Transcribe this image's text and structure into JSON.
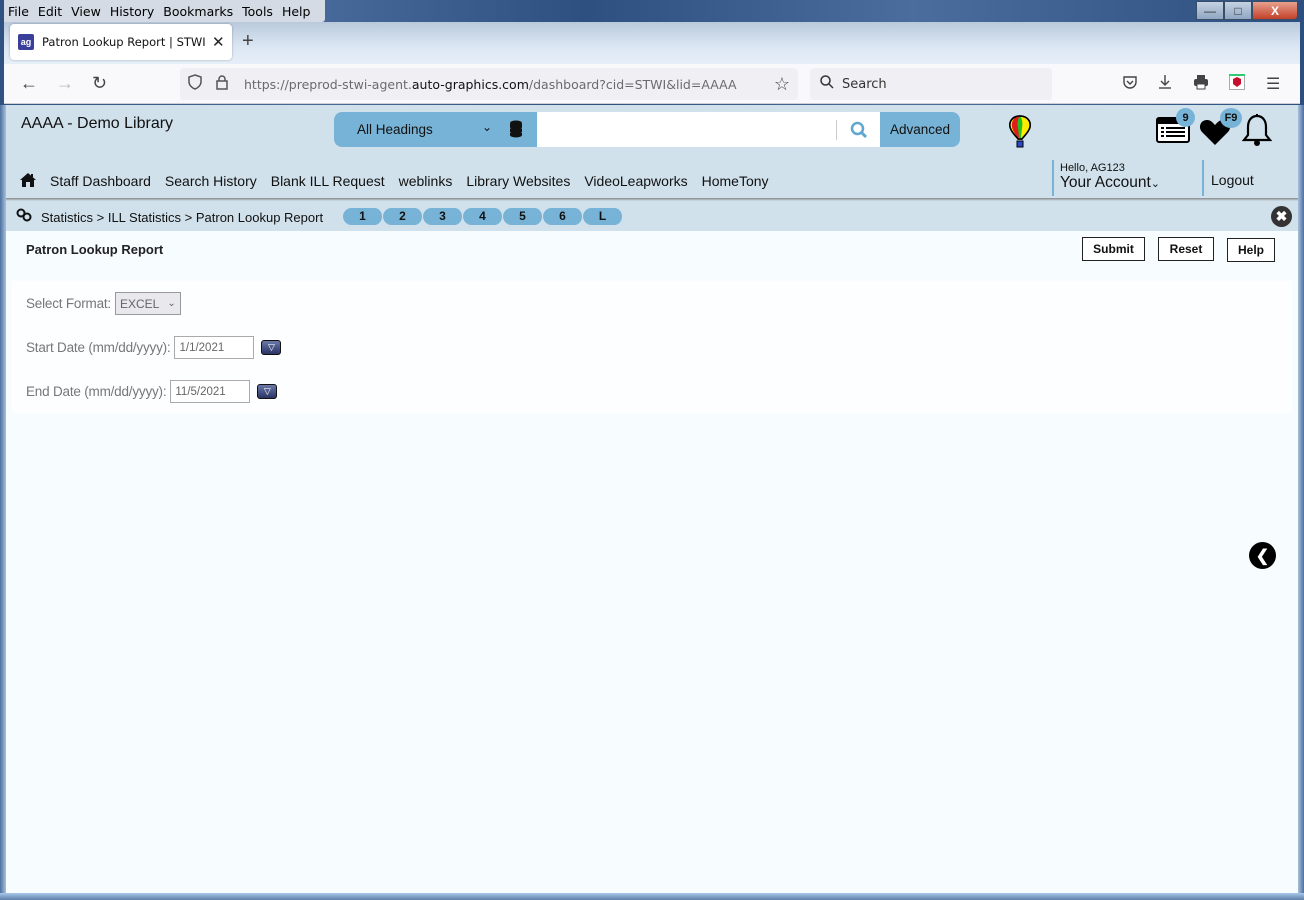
{
  "browser": {
    "menu": [
      "File",
      "Edit",
      "View",
      "History",
      "Bookmarks",
      "Tools",
      "Help"
    ],
    "tab_title": "Patron Lookup Report | STWI | a",
    "favicon_text": "ag",
    "url_prefix": "https://preprod-stwi-agent.",
    "url_domain": "auto-graphics.com",
    "url_suffix": "/dashboard?cid=STWI&lid=AAAA",
    "search_placeholder": "Search"
  },
  "header": {
    "library_name": "AAAA - Demo Library",
    "search_scope": "All Headings",
    "search_value": "",
    "advanced_label": "Advanced",
    "list_badge": "9",
    "favorites_badge": "F9",
    "hello": "Hello, AG123",
    "account_label": "Your Account",
    "logout_label": "Logout"
  },
  "nav": {
    "items": [
      "Staff Dashboard",
      "Search History",
      "Blank ILL Request",
      "weblinks",
      "Library Websites",
      "VideoLeapworks",
      "HomeTony"
    ],
    "active": "Staff Dashboard"
  },
  "breadcrumb": {
    "path": "Statistics > ILL Statistics > Patron Lookup Report",
    "pills": [
      "1",
      "2",
      "3",
      "4",
      "5",
      "6",
      "L"
    ]
  },
  "report": {
    "title": "Patron Lookup Report",
    "submit_label": "Submit",
    "reset_label": "Reset",
    "help_label": "Help",
    "format_label": "Select Format:",
    "format_value": "EXCEL",
    "start_label": "Start Date (mm/dd/yyyy):",
    "start_value": "1/1/2021",
    "end_label": "End Date (mm/dd/yyyy):",
    "end_value": "11/5/2021"
  },
  "colors": {
    "header_bg": "#d0e1ec",
    "accent": "#77b3d6"
  }
}
